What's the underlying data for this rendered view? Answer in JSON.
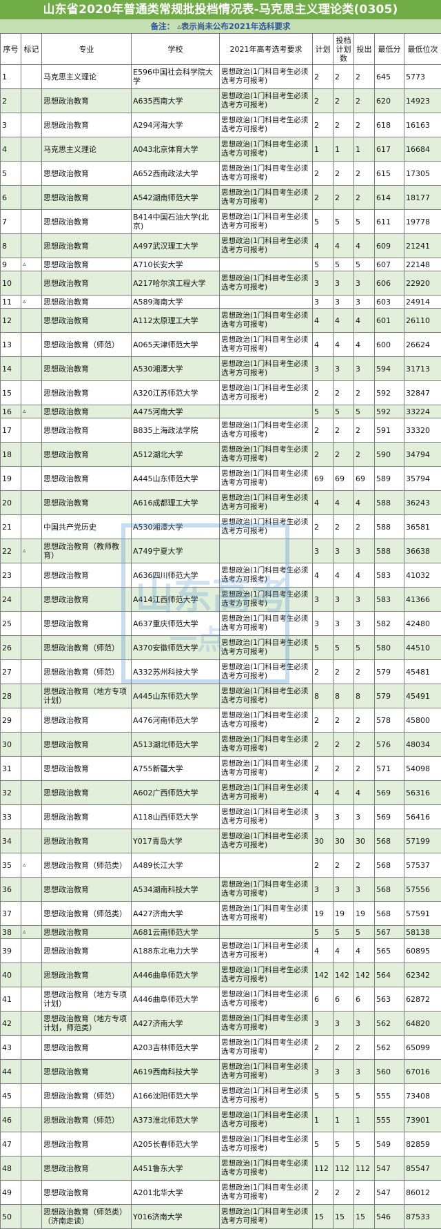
{
  "title": "山东省2020年普通类常规批投档情况表-马克思主义理论类(0305)",
  "note": "备注：  ▵表示尚未公布2021年选科要求",
  "watermark": {
    "text": "山东高考",
    "sub": "一点"
  },
  "headers": [
    "序号",
    "标记",
    "专业",
    "学校",
    "2021年高考选考要求",
    "计划",
    "投档计划数",
    "投出",
    "最低分",
    "最低位次"
  ],
  "rows": [
    {
      "seq": "1",
      "mark": "",
      "major": "马克思主义理论",
      "school": "E596中国社会科学院大学",
      "req": "思想政治(1门科目考生必须选考方可报考)",
      "plan": "2",
      "tplan": "2",
      "out": "2",
      "score": "645",
      "rank": "5773"
    },
    {
      "seq": "2",
      "mark": "",
      "major": "思想政治教育",
      "school": "A635西南大学",
      "req": "思想政治(1门科目考生必须选考方可报考)",
      "plan": "2",
      "tplan": "2",
      "out": "2",
      "score": "620",
      "rank": "14923"
    },
    {
      "seq": "3",
      "mark": "",
      "major": "思想政治教育",
      "school": "A294河海大学",
      "req": "思想政治(1门科目考生必须选考方可报考)",
      "plan": "2",
      "tplan": "2",
      "out": "2",
      "score": "618",
      "rank": "16163"
    },
    {
      "seq": "4",
      "mark": "",
      "major": "马克思主义理论",
      "school": "A043北京体育大学",
      "req": "思想政治(1门科目考生必须选考方可报考)",
      "plan": "1",
      "tplan": "1",
      "out": "1",
      "score": "617",
      "rank": "16684"
    },
    {
      "seq": "5",
      "mark": "",
      "major": "思想政治教育",
      "school": "A652西南政法大学",
      "req": "思想政治(1门科目考生必须选考方可报考)",
      "plan": "2",
      "tplan": "2",
      "out": "2",
      "score": "615",
      "rank": "17305"
    },
    {
      "seq": "6",
      "mark": "",
      "major": "思想政治教育",
      "school": "A542湖南师范大学",
      "req": "思想政治(1门科目考生必须选考方可报考)",
      "plan": "2",
      "tplan": "2",
      "out": "2",
      "score": "614",
      "rank": "18177"
    },
    {
      "seq": "7",
      "mark": "",
      "major": "思想政治教育",
      "school": "B414中国石油大学(北京)",
      "req": "思想政治(1门科目考生必须选考方可报考)",
      "plan": "5",
      "tplan": "5",
      "out": "5",
      "score": "611",
      "rank": "19778"
    },
    {
      "seq": "8",
      "mark": "",
      "major": "思想政治教育",
      "school": "A497武汉理工大学",
      "req": "思想政治(1门科目考生必须选考方可报考)",
      "plan": "4",
      "tplan": "4",
      "out": "4",
      "score": "609",
      "rank": "21241"
    },
    {
      "seq": "9",
      "mark": "▵",
      "major": "思想政治教育",
      "school": "A710长安大学",
      "req": "",
      "plan": "5",
      "tplan": "5",
      "out": "5",
      "score": "607",
      "rank": "22148"
    },
    {
      "seq": "10",
      "mark": "",
      "major": "思想政治教育",
      "school": "A217哈尔滨工程大学",
      "req": "思想政治(1门科目考生必须选考方可报考)",
      "plan": "3",
      "tplan": "3",
      "out": "3",
      "score": "606",
      "rank": "22920"
    },
    {
      "seq": "11",
      "mark": "▵",
      "major": "思想政治教育",
      "school": "A589海南大学",
      "req": "",
      "plan": "3",
      "tplan": "3",
      "out": "3",
      "score": "603",
      "rank": "24914"
    },
    {
      "seq": "12",
      "mark": "",
      "major": "思想政治教育",
      "school": "A112太原理工大学",
      "req": "思想政治(1门科目考生必须选考方可报考)",
      "plan": "4",
      "tplan": "4",
      "out": "4",
      "score": "601",
      "rank": "26110"
    },
    {
      "seq": "13",
      "mark": "",
      "major": "思想政治教育（师范）",
      "school": "A065天津师范大学",
      "req": "思想政治(1门科目考生必须选考方可报考)",
      "plan": "4",
      "tplan": "4",
      "out": "4",
      "score": "600",
      "rank": "26624"
    },
    {
      "seq": "14",
      "mark": "",
      "major": "思想政治教育",
      "school": "A530湘潭大学",
      "req": "思想政治(1门科目考生必须选考方可报考)",
      "plan": "3",
      "tplan": "3",
      "out": "3",
      "score": "594",
      "rank": "31713"
    },
    {
      "seq": "15",
      "mark": "",
      "major": "思想政治教育",
      "school": "A320江苏师范大学",
      "req": "思想政治(1门科目考生必须选考方可报考)",
      "plan": "2",
      "tplan": "2",
      "out": "2",
      "score": "592",
      "rank": "32847"
    },
    {
      "seq": "16",
      "mark": "▵",
      "major": "思想政治教育",
      "school": "A475河南大学",
      "req": "",
      "plan": "5",
      "tplan": "5",
      "out": "5",
      "score": "592",
      "rank": "33224"
    },
    {
      "seq": "17",
      "mark": "",
      "major": "思想政治教育",
      "school": "B835上海政法学院",
      "req": "思想政治(1门科目考生必须选考方可报考)",
      "plan": "2",
      "tplan": "2",
      "out": "2",
      "score": "591",
      "rank": "33320"
    },
    {
      "seq": "18",
      "mark": "",
      "major": "思想政治教育",
      "school": "A512湖北大学",
      "req": "思想政治(1门科目考生必须选考方可报考)",
      "plan": "2",
      "tplan": "2",
      "out": "2",
      "score": "590",
      "rank": "34794"
    },
    {
      "seq": "19",
      "mark": "",
      "major": "思想政治教育",
      "school": "A445山东师范大学",
      "req": "思想政治(1门科目考生必须选考方可报考)",
      "plan": "69",
      "tplan": "69",
      "out": "69",
      "score": "589",
      "rank": "35794"
    },
    {
      "seq": "20",
      "mark": "",
      "major": "思想政治教育",
      "school": "A616成都理工大学",
      "req": "思想政治(1门科目考生必须选考方可报考)",
      "plan": "4",
      "tplan": "4",
      "out": "4",
      "score": "588",
      "rank": "36243"
    },
    {
      "seq": "21",
      "mark": "",
      "major": "中国共产党历史",
      "school": "A530湘潭大学",
      "req": "思想政治(1门科目考生必须选考方可报考)",
      "plan": "2",
      "tplan": "2",
      "out": "2",
      "score": "588",
      "rank": "36581"
    },
    {
      "seq": "22",
      "mark": "▵",
      "major": "思想政治教育（教师教育）",
      "school": "A749宁夏大学",
      "req": "",
      "plan": "3",
      "tplan": "3",
      "out": "3",
      "score": "588",
      "rank": "36638"
    },
    {
      "seq": "23",
      "mark": "",
      "major": "思想政治教育",
      "school": "A636四川师范大学",
      "req": "思想政治(1门科目考生必须选考方可报考)",
      "plan": "4",
      "tplan": "4",
      "out": "4",
      "score": "583",
      "rank": "41032"
    },
    {
      "seq": "24",
      "mark": "",
      "major": "思想政治教育",
      "school": "A414江西师范大学",
      "req": "思想政治(1门科目考生必须选考方可报考)",
      "plan": "3",
      "tplan": "3",
      "out": "3",
      "score": "583",
      "rank": "41366"
    },
    {
      "seq": "25",
      "mark": "",
      "major": "思想政治教育",
      "school": "A637重庆师范大学",
      "req": "思想政治(1门科目考生必须选考方可报考)",
      "plan": "3",
      "tplan": "3",
      "out": "3",
      "score": "582",
      "rank": "42480"
    },
    {
      "seq": "26",
      "mark": "",
      "major": "思想政治教育（师范）",
      "school": "A370安徽师范大学",
      "req": "思想政治(1门科目考生必须选考方可报考)",
      "plan": "5",
      "tplan": "5",
      "out": "5",
      "score": "580",
      "rank": "44510"
    },
    {
      "seq": "27",
      "mark": "",
      "major": "思想政治教育（师范）",
      "school": "A332苏州科技大学",
      "req": "思想政治(1门科目考生必须选考方可报考)",
      "plan": "2",
      "tplan": "2",
      "out": "2",
      "score": "579",
      "rank": "45481"
    },
    {
      "seq": "28",
      "mark": "",
      "major": "思想政治教育（地方专项计划）",
      "school": "A445山东师范大学",
      "req": "思想政治(1门科目考生必须选考方可报考)",
      "plan": "8",
      "tplan": "8",
      "out": "8",
      "score": "579",
      "rank": "45491"
    },
    {
      "seq": "29",
      "mark": "",
      "major": "思想政治教育",
      "school": "A476河南师范大学",
      "req": "思想政治(1门科目考生必须选考方可报考)",
      "plan": "2",
      "tplan": "2",
      "out": "2",
      "score": "578",
      "rank": "45800"
    },
    {
      "seq": "30",
      "mark": "",
      "major": "思想政治教育",
      "school": "A513湖北师范大学",
      "req": "思想政治(1门科目考生必须选考方可报考)",
      "plan": "2",
      "tplan": "2",
      "out": "2",
      "score": "576",
      "rank": "48034"
    },
    {
      "seq": "31",
      "mark": "",
      "major": "思想政治教育",
      "school": "A755新疆大学",
      "req": "思想政治(1门科目考生必须选考方可报考)",
      "plan": "2",
      "tplan": "2",
      "out": "2",
      "score": "571",
      "rank": "54098"
    },
    {
      "seq": "32",
      "mark": "",
      "major": "思想政治教育",
      "school": "A602广西师范大学",
      "req": "思想政治(1门科目考生必须选考方可报考)",
      "plan": "4",
      "tplan": "4",
      "out": "4",
      "score": "569",
      "rank": "56316"
    },
    {
      "seq": "33",
      "mark": "",
      "major": "思想政治教育",
      "school": "A118山西师范大学",
      "req": "思想政治(1门科目考生必须选考方可报考)",
      "plan": "3",
      "tplan": "3",
      "out": "3",
      "score": "569",
      "rank": "56416"
    },
    {
      "seq": "34",
      "mark": "",
      "major": "思想政治教育",
      "school": "Y017青岛大学",
      "req": "思想政治(1门科目考生必须选考方可报考)",
      "plan": "30",
      "tplan": "30",
      "out": "30",
      "score": "568",
      "rank": "57199"
    },
    {
      "seq": "35",
      "mark": "▵",
      "major": "思想政治教育（师范类）",
      "school": "A489长江大学",
      "req": "",
      "plan": "2",
      "tplan": "2",
      "out": "2",
      "score": "568",
      "rank": "57537"
    },
    {
      "seq": "36",
      "mark": "",
      "major": "思想政治教育",
      "school": "A534湖南科技大学",
      "req": "思想政治(1门科目考生必须选考方可报考)",
      "plan": "3",
      "tplan": "3",
      "out": "3",
      "score": "568",
      "rank": "57556"
    },
    {
      "seq": "37",
      "mark": "",
      "major": "思想政治教育（师范类）",
      "school": "A427济南大学",
      "req": "思想政治(1门科目考生必须选考方可报考)",
      "plan": "19",
      "tplan": "19",
      "out": "19",
      "score": "568",
      "rank": "57591"
    },
    {
      "seq": "38",
      "mark": "▵",
      "major": "思想政治教育",
      "school": "A681云南师范大学",
      "req": "",
      "plan": "5",
      "tplan": "5",
      "out": "5",
      "score": "567",
      "rank": "58138"
    },
    {
      "seq": "39",
      "mark": "",
      "major": "思想政治教育",
      "school": "A188东北电力大学",
      "req": "思想政治(1门科目考生必须选考方可报考)",
      "plan": "4",
      "tplan": "4",
      "out": "4",
      "score": "565",
      "rank": "60895"
    },
    {
      "seq": "40",
      "mark": "",
      "major": "思想政治教育",
      "school": "A446曲阜师范大学",
      "req": "思想政治(1门科目考生必须选考方可报考)",
      "plan": "142",
      "tplan": "142",
      "out": "142",
      "score": "564",
      "rank": "62342"
    },
    {
      "seq": "41",
      "mark": "",
      "major": "思想政治教育（地方专项计划）",
      "school": "A446曲阜师范大学",
      "req": "思想政治(1门科目考生必须选考方可报考)",
      "plan": "6",
      "tplan": "6",
      "out": "6",
      "score": "563",
      "rank": "62872"
    },
    {
      "seq": "42",
      "mark": "",
      "major": "思想政治教育（地方专项计划，师范类）",
      "school": "A427济南大学",
      "req": "思想政治(1门科目考生必须选考方可报考)",
      "plan": "3",
      "tplan": "3",
      "out": "3",
      "score": "562",
      "rank": "64820"
    },
    {
      "seq": "43",
      "mark": "",
      "major": "思想政治教育",
      "school": "A203吉林师范大学",
      "req": "思想政治(1门科目考生必须选考方可报考)",
      "plan": "2",
      "tplan": "2",
      "out": "2",
      "score": "562",
      "rank": "65099"
    },
    {
      "seq": "44",
      "mark": "",
      "major": "思想政治教育",
      "school": "A619西南科技大学",
      "req": "思想政治(1门科目考生必须选考方可报考)",
      "plan": "3",
      "tplan": "3",
      "out": "3",
      "score": "560",
      "rank": "67016"
    },
    {
      "seq": "45",
      "mark": "",
      "major": "思想政治教育（师范）",
      "school": "A166沈阳师范大学",
      "req": "思想政治(1门科目考生必须选考方可报考)",
      "plan": "5",
      "tplan": "5",
      "out": "5",
      "score": "555",
      "rank": "73408"
    },
    {
      "seq": "46",
      "mark": "",
      "major": "思想政治教育（师范）",
      "school": "A373淮北师范大学",
      "req": "思想政治(1门科目考生必须选考方可报考)",
      "plan": "1",
      "tplan": "1",
      "out": "1",
      "score": "555",
      "rank": "73901"
    },
    {
      "seq": "47",
      "mark": "",
      "major": "思想政治教育",
      "school": "A205长春师范大学",
      "req": "思想政治(1门科目考生必须选考方可报考)",
      "plan": "5",
      "tplan": "5",
      "out": "5",
      "score": "549",
      "rank": "82859"
    },
    {
      "seq": "48",
      "mark": "",
      "major": "思想政治教育",
      "school": "A451鲁东大学",
      "req": "思想政治(1门科目考生必须选考方可报考)",
      "plan": "112",
      "tplan": "112",
      "out": "112",
      "score": "547",
      "rank": "85547"
    },
    {
      "seq": "49",
      "mark": "",
      "major": "思想政治教育",
      "school": "A201北华大学",
      "req": "思想政治(1门科目考生必须选考方可报考)",
      "plan": "2",
      "tplan": "2",
      "out": "2",
      "score": "547",
      "rank": "86012"
    },
    {
      "seq": "50",
      "mark": "",
      "major": "思想政治教育（师范类）（济南走读）",
      "school": "Y016济南大学",
      "req": "思想政治(1门科目考生必须选考方可报考)",
      "plan": "15",
      "tplan": "15",
      "out": "15",
      "score": "546",
      "rank": "87533"
    }
  ]
}
